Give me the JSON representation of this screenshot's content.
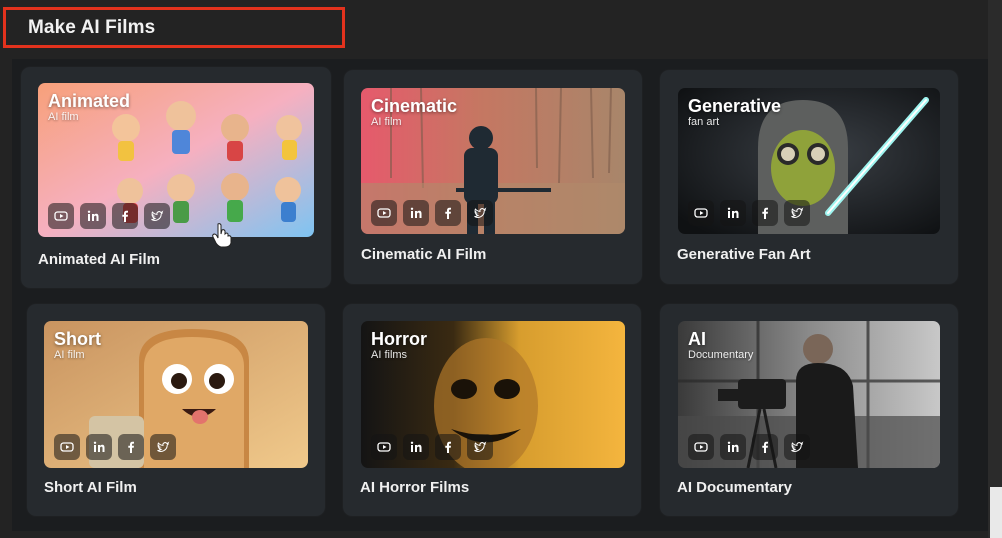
{
  "section": {
    "title": "Make AI Films"
  },
  "colors": {
    "highlight_border": "#e2321d",
    "card_bg": "#262a2e",
    "page_bg": "#232323"
  },
  "social_icons": [
    "youtube-icon",
    "linkedin-icon",
    "facebook-icon",
    "twitter-icon"
  ],
  "cards": [
    {
      "label": "Animated AI Film",
      "thumb_title": "Animated",
      "thumb_sub": "AI film"
    },
    {
      "label": "Cinematic AI Film",
      "thumb_title": "Cinematic",
      "thumb_sub": "AI film"
    },
    {
      "label": "Generative Fan Art",
      "thumb_title": "Generative",
      "thumb_sub": "fan art"
    },
    {
      "label": "Short AI Film",
      "thumb_title": "Short",
      "thumb_sub": "AI film"
    },
    {
      "label": "AI Horror Films",
      "thumb_title": "Horror",
      "thumb_sub": "AI films"
    },
    {
      "label": "AI Documentary",
      "thumb_title": "AI",
      "thumb_sub": "Documentary"
    }
  ]
}
